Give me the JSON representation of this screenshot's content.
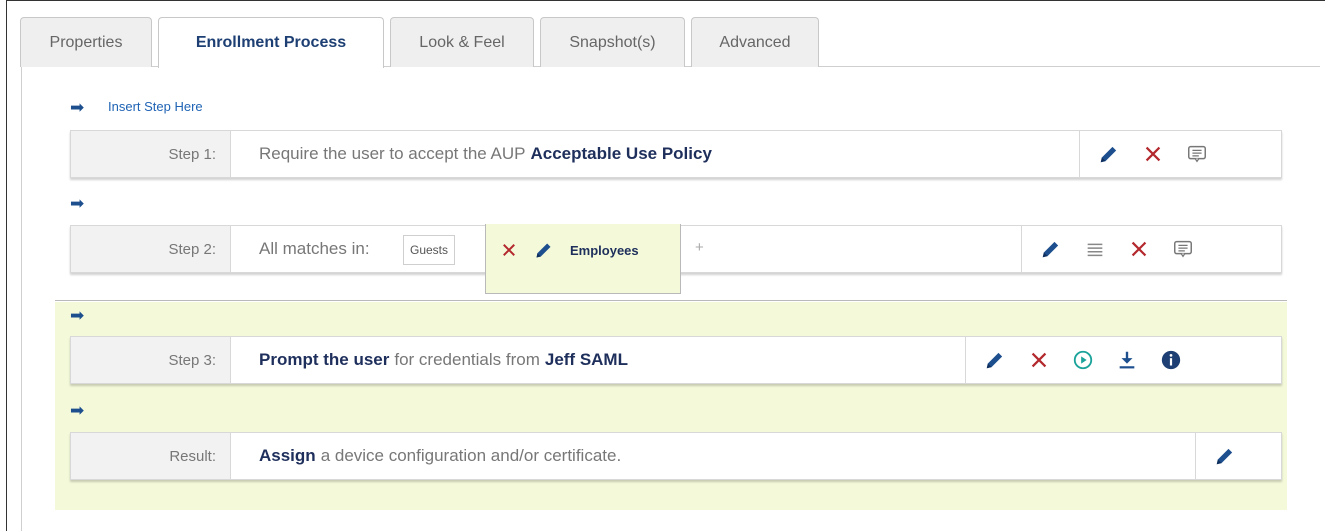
{
  "tabs": [
    {
      "label": "Properties",
      "active": false
    },
    {
      "label": "Enrollment Process",
      "active": true
    },
    {
      "label": "Look & Feel",
      "active": false
    },
    {
      "label": "Snapshot(s)",
      "active": false
    },
    {
      "label": "Advanced",
      "active": false
    }
  ],
  "insert_step_label": "Insert Step Here",
  "steps": [
    {
      "label": "Step 1:",
      "text_before": "Require the user to accept the AUP",
      "bold": "Acceptable Use Policy"
    },
    {
      "label": "Step 2:",
      "text_before": "All matches in:",
      "groups": [
        "Guests",
        "Employees"
      ],
      "add_symbol": "+"
    },
    {
      "label": "Step 3:",
      "bold_start": "Prompt the user",
      "text_middle": "for credentials from",
      "bold_end": "Jeff SAML"
    },
    {
      "label": "Result:",
      "bold_start": "Assign",
      "text_after": "a device configuration and/or certificate."
    }
  ],
  "colors": {
    "accent_blue": "#1d4f8f",
    "delete_red": "#b3282d",
    "play_teal": "#1aa39a",
    "active_zone": "#f3f9d9"
  },
  "icons": [
    "arrow-right-icon",
    "pencil-icon",
    "close-icon",
    "comment-icon",
    "list-icon",
    "play-circle-icon",
    "download-icon",
    "info-icon"
  ]
}
